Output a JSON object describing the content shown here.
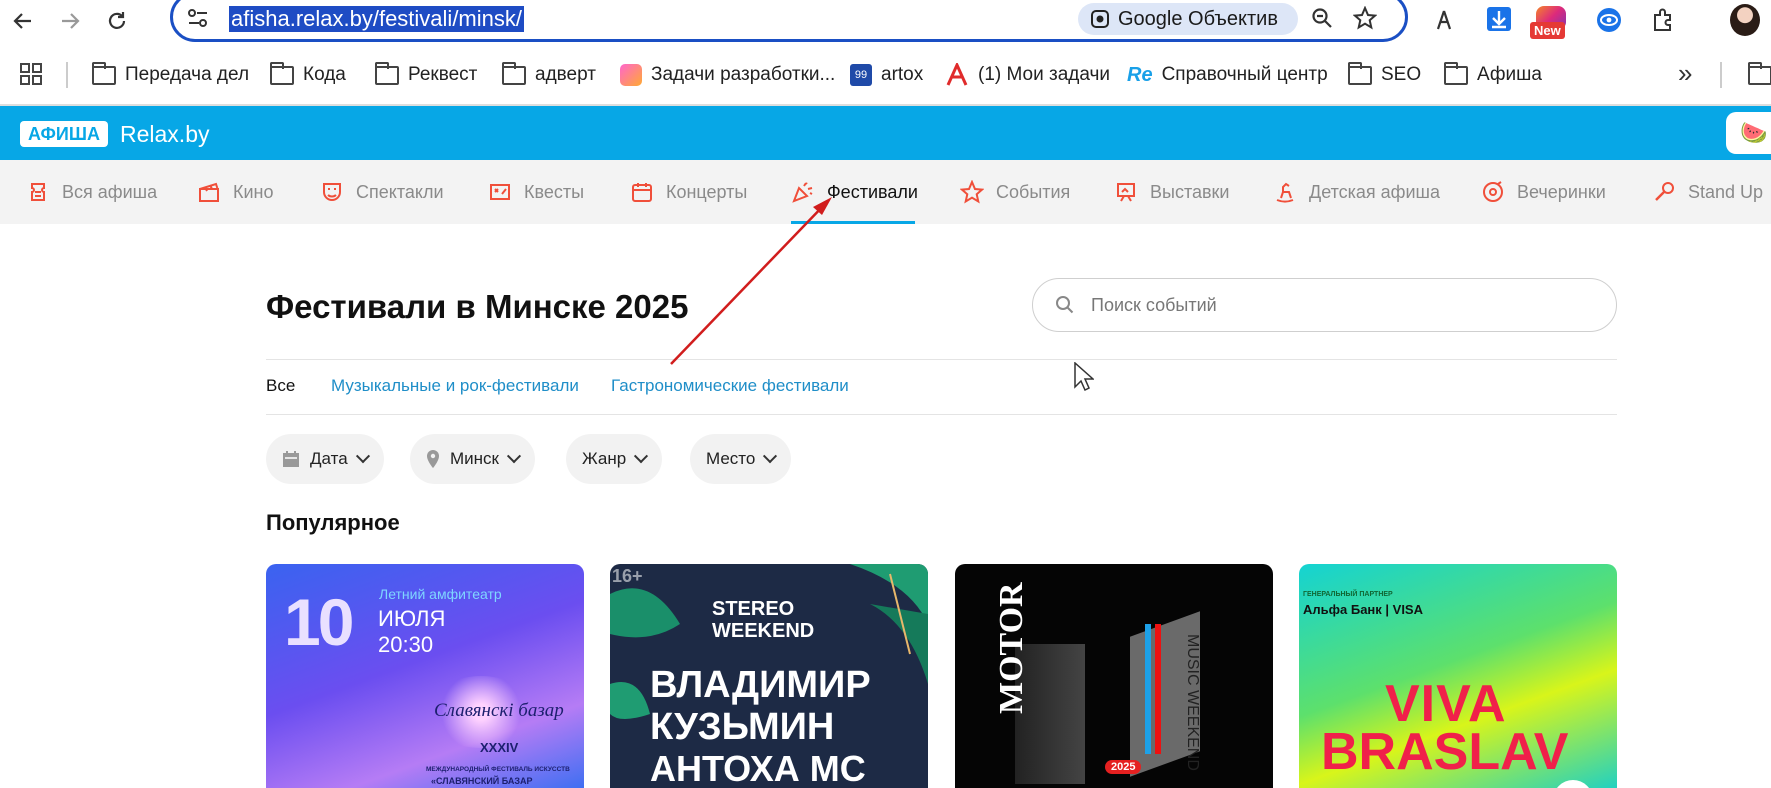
{
  "browser": {
    "url": "afisha.relax.by/festivali/minsk/",
    "lens_label": "Google Объектив",
    "new_badge": "New"
  },
  "bookmarks": [
    {
      "label": "Передача дел",
      "icon": "folder-icon"
    },
    {
      "label": "Кода",
      "icon": "folder-icon"
    },
    {
      "label": "Реквест",
      "icon": "folder-icon"
    },
    {
      "label": "адверт",
      "icon": "folder-icon"
    },
    {
      "label": "Задачи разработки...",
      "icon": "app-icon"
    },
    {
      "label": "artox",
      "icon": "artox-icon"
    },
    {
      "label": "(1) Мои задачи",
      "icon": "tasks-icon"
    },
    {
      "label": "Справочный центр",
      "icon": "re-icon"
    },
    {
      "label": "SEO",
      "icon": "folder-icon"
    },
    {
      "label": "Афиша",
      "icon": "folder-icon"
    }
  ],
  "site": {
    "logo_box": "АФИША",
    "logo_text": "Relax.by",
    "categories": [
      {
        "label": "Вся афиша"
      },
      {
        "label": "Кино"
      },
      {
        "label": "Спектакли"
      },
      {
        "label": "Квесты"
      },
      {
        "label": "Концерты"
      },
      {
        "label": "Фестивали",
        "active": true
      },
      {
        "label": "События"
      },
      {
        "label": "Выставки"
      },
      {
        "label": "Детская афиша"
      },
      {
        "label": "Вечеринки"
      },
      {
        "label": "Stand Up"
      }
    ]
  },
  "main": {
    "title": "Фестивали в Минске 2025",
    "search_placeholder": "Поиск событий",
    "subcategories": [
      "Все",
      "Музыкальные и рок-фестивали",
      "Гастрономические фестивали"
    ],
    "filters": [
      "Дата",
      "Минск",
      "Жанр",
      "Место"
    ],
    "popular_title": "Популярное",
    "cards": [
      {
        "day": "10",
        "venue": "Летний амфитеатр",
        "month": "ИЮЛЯ",
        "time": "20:30",
        "logo_text": "Славянскі базар",
        "edition": "XXXIV",
        "caption": "МЕЖДУНАРОДНЫЙ ФЕСТИВАЛЬ ИСКУССТВ",
        "caption2": "«СЛАВЯНСКИЙ БАЗАР"
      },
      {
        "age": "16+",
        "brand1": "STEREO",
        "brand2": "WEEKEND",
        "line1": "ВЛАДИМИР",
        "line2": "КУЗЬМИН",
        "line3": "АНТОХА МС"
      },
      {
        "brand": "MOTOR",
        "sub": "MUSIC WEEKEND",
        "year": "2025"
      },
      {
        "partner_label": "ГЕНЕРАЛЬНЫЙ ПАРТНЕР",
        "partner": "Альфа Банк | VISA",
        "title1": "VIVA",
        "title2": "BRASLAV"
      }
    ]
  },
  "colors": {
    "brand_blue": "#07a7e6",
    "accent_red": "#f04f3a",
    "link": "#1f8ec8",
    "annotation_arrow": "#d11d1d"
  }
}
